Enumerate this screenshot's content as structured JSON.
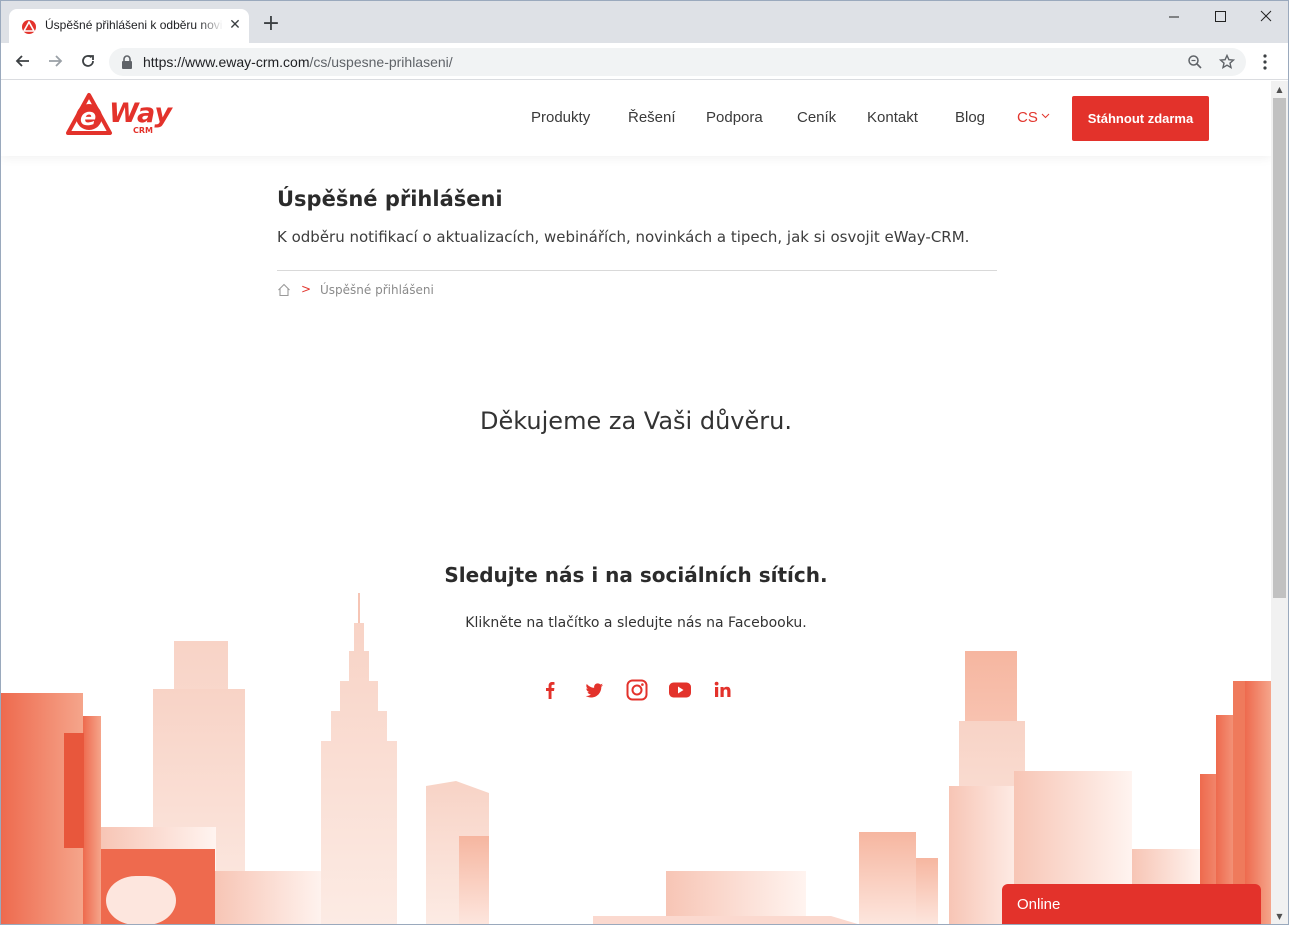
{
  "browser": {
    "tab_title": "Úspěšné přihlášeni k odběru novinek",
    "tab_close": "✕",
    "new_tab": "+",
    "url_host": "https://www.eway-crm.com",
    "url_path": "/cs/uspesne-prihlaseni/"
  },
  "header": {
    "logo_text": "eWay CRM",
    "nav": [
      "Produkty",
      "Řešení",
      "Podpora",
      "Ceník",
      "Kontakt",
      "Blog"
    ],
    "lang": "CS",
    "cta": "Stáhnout zdarma"
  },
  "main": {
    "title": "Úspěšné přihlášeni",
    "subtitle": "K odběru notifikací o aktualizacích, webinářích, novinkách a tipech, jak si osvojit eWay-CRM.",
    "breadcrumb_sep": ">",
    "breadcrumb_current": "Úspěšné přihlášeni",
    "thanks": "Děkujeme za Vaši důvěru."
  },
  "social": {
    "title": "Sledujte nás i na sociálních sítích.",
    "text": "Klikněte na tlačítko a sledujte nás na Facebooku.",
    "icons": [
      "facebook-icon",
      "twitter-icon",
      "instagram-icon",
      "youtube-icon",
      "linkedin-icon"
    ]
  },
  "chat": {
    "label": "Online"
  },
  "colors": {
    "brand": "#e3322b",
    "chrome_bg": "#dee1e6"
  }
}
